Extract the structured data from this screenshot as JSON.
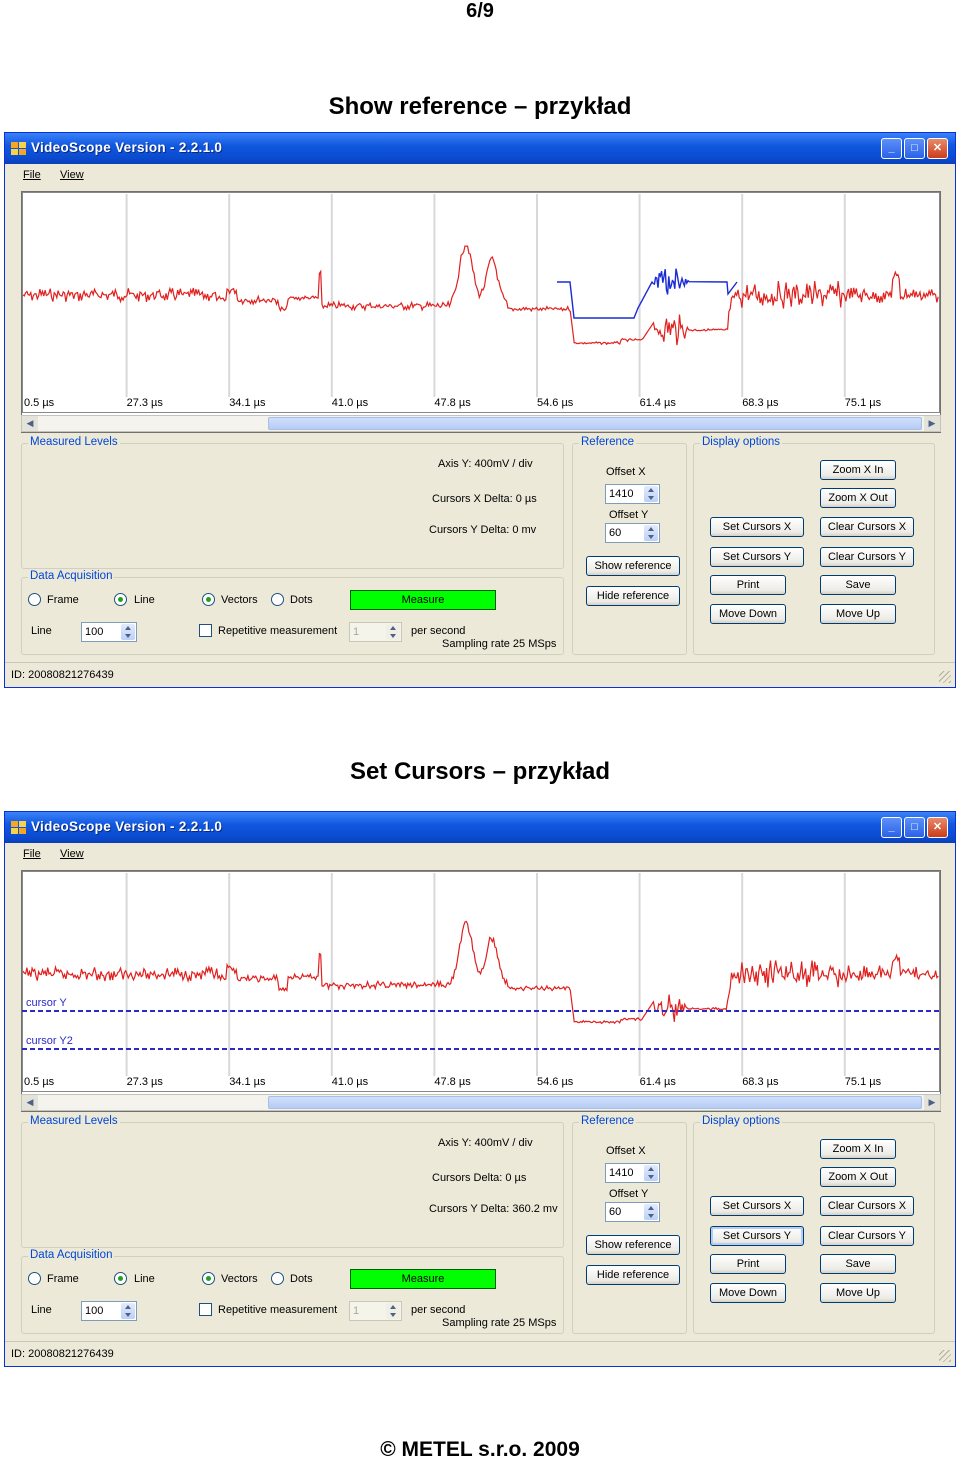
{
  "page_number": "6/9",
  "footer": "© METEL s.r.o. 2009",
  "screenshots": [
    {
      "heading": "Show reference – przykład",
      "window_title": "VideoScope Version - 2.2.1.0",
      "menu": [
        "File",
        "View"
      ],
      "plot": {
        "time_labels": [
          "0.5 µs",
          "27.3 µs",
          "34.1 µs",
          "41.0 µs",
          "47.8 µs",
          "54.6 µs",
          "61.4 µs",
          "68.3 µs",
          "75.1 µs"
        ],
        "cursor_labels": [],
        "show_reference": true,
        "show_cursors": false
      },
      "measured_levels": {
        "title": "Measured Levels",
        "axis_y": "Axis Y: 400mV / div",
        "cursors_x_delta": "Cursors X Delta: 0 µs",
        "cursors_y_delta": "Cursors Y Delta: 0 mv"
      },
      "data_acquisition": {
        "title": "Data Acquisition",
        "radio_frame": "Frame",
        "radio_line": "Line",
        "radio_vectors": "Vectors",
        "radio_dots": "Dots",
        "measure_button": "Measure",
        "line_label": "Line",
        "line_value": "100",
        "repetitive_label": "Repetitive measurement",
        "repetitive_value": "1",
        "per_second": "per second",
        "sampling_rate": "Sampling rate 25 MSps"
      },
      "reference": {
        "title": "Reference",
        "offset_x_label": "Offset X",
        "offset_x_value": "1410",
        "offset_y_label": "Offset Y",
        "offset_y_value": "60",
        "show_button": "Show reference",
        "hide_button": "Hide reference"
      },
      "display_options": {
        "title": "Display options",
        "zoom_x_in": "Zoom X In",
        "zoom_x_out": "Zoom X Out",
        "set_cursors_x": "Set Cursors X",
        "clear_cursors_x": "Clear Cursors X",
        "set_cursors_y": "Set Cursors Y",
        "clear_cursors_y": "Clear Cursors Y",
        "print": "Print",
        "save": "Save",
        "move_down": "Move Down",
        "move_up": "Move Up"
      },
      "status_id": "ID: 20080821276439"
    },
    {
      "heading": "Set Cursors – przykład",
      "window_title": "VideoScope Version - 2.2.1.0",
      "menu": [
        "File",
        "View"
      ],
      "plot": {
        "time_labels": [
          "0.5 µs",
          "27.3 µs",
          "34.1 µs",
          "41.0 µs",
          "47.8 µs",
          "54.6 µs",
          "61.4 µs",
          "68.3 µs",
          "75.1 µs"
        ],
        "cursor_labels": [
          "cursor Y",
          "cursor Y2"
        ],
        "show_reference": false,
        "show_cursors": true
      },
      "measured_levels": {
        "title": "Measured Levels",
        "axis_y": "Axis Y: 400mV / div",
        "cursors_x_delta": "Cursors Delta: 0 µs",
        "cursors_y_delta": "Cursors Y Delta: 360.2 mv"
      },
      "data_acquisition": {
        "title": "Data Acquisition",
        "radio_frame": "Frame",
        "radio_line": "Line",
        "radio_vectors": "Vectors",
        "radio_dots": "Dots",
        "measure_button": "Measure",
        "line_label": "Line",
        "line_value": "100",
        "repetitive_label": "Repetitive measurement",
        "repetitive_value": "1",
        "per_second": "per second",
        "sampling_rate": "Sampling rate 25 MSps"
      },
      "reference": {
        "title": "Reference",
        "offset_x_label": "Offset X",
        "offset_x_value": "1410",
        "offset_y_label": "Offset Y",
        "offset_y_value": "60",
        "show_button": "Show reference",
        "hide_button": "Hide reference"
      },
      "display_options": {
        "title": "Display options",
        "zoom_x_in": "Zoom X In",
        "zoom_x_out": "Zoom X Out",
        "set_cursors_x": "Set Cursors X",
        "clear_cursors_x": "Clear Cursors X",
        "set_cursors_y": "Set Cursors Y",
        "clear_cursors_y": "Clear Cursors Y",
        "print": "Print",
        "save": "Save",
        "move_down": "Move Down",
        "move_up": "Move Up"
      },
      "status_id": "ID: 20080821276439"
    }
  ],
  "colors": {
    "signal": "#e0201e",
    "reference": "#1a2bd6",
    "cursor": "#2a2ac8",
    "measure_button": "#00ff00",
    "titlebar": "#0a4bd0",
    "group_label": "#0046d5"
  }
}
